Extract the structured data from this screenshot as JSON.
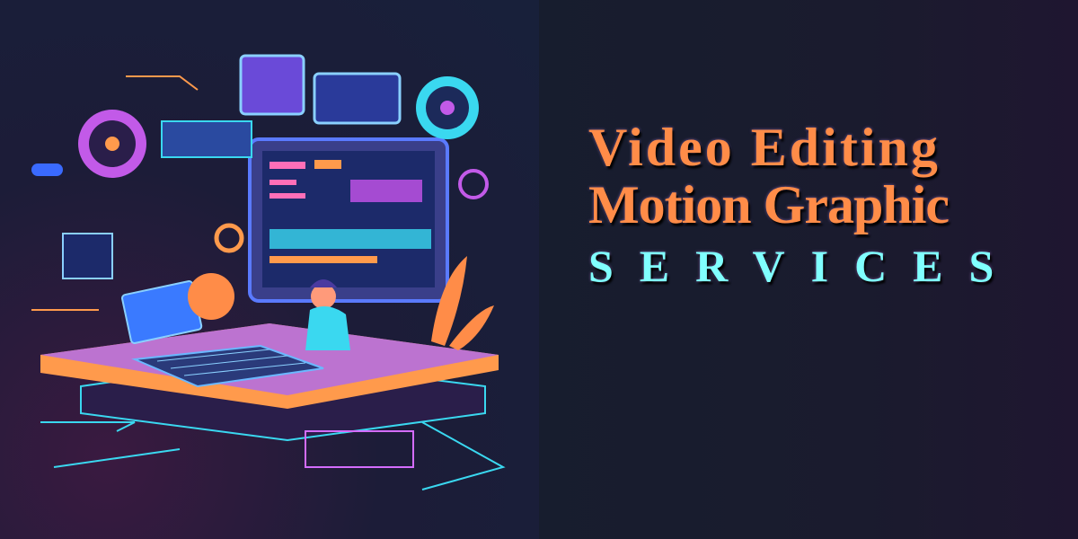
{
  "headline": {
    "line1": "Video Editing",
    "line2": "Motion Graphic",
    "line3": "SERVICES"
  },
  "colors": {
    "headline_orange": "#ff8c48",
    "headline_cyan": "#80ffff",
    "background": "#181a2c"
  },
  "illustration": {
    "subject": "video-editor-workstation-illustration"
  }
}
